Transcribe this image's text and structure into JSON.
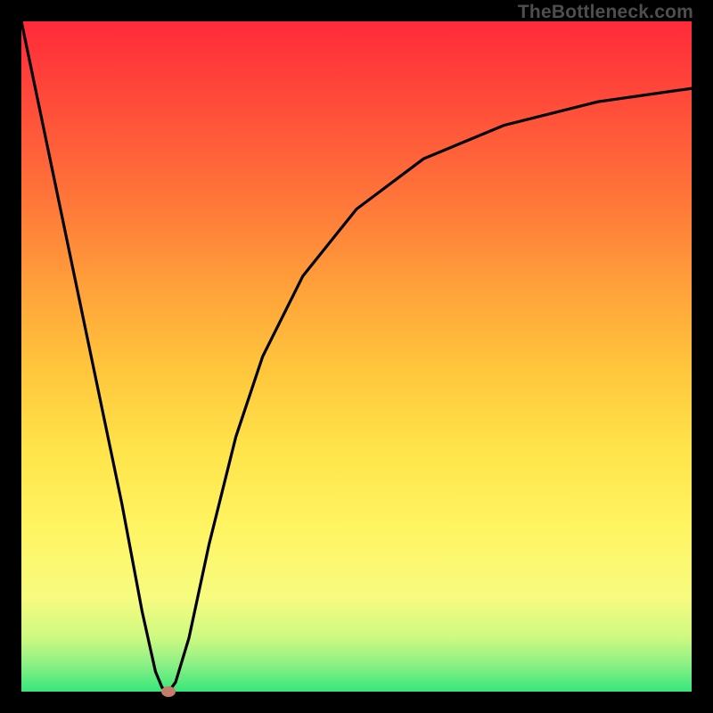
{
  "watermark": "TheBottleneck.com",
  "chart_data": {
    "type": "line",
    "title": "",
    "xlabel": "",
    "ylabel": "",
    "xlim": [
      0,
      100
    ],
    "ylim": [
      0,
      100
    ],
    "grid": false,
    "series": [
      {
        "name": "curve",
        "x": [
          0,
          5,
          10,
          15,
          18,
          20,
          21,
          22,
          23,
          25,
          28,
          32,
          36,
          42,
          50,
          60,
          72,
          86,
          100
        ],
        "y": [
          100,
          76,
          52,
          28,
          12,
          3,
          0.6,
          0,
          1.4,
          8,
          22,
          38,
          50,
          62,
          72,
          79.5,
          84.5,
          88,
          90
        ]
      }
    ],
    "marker": {
      "x": 22,
      "y": 0,
      "color": "#c77b6a"
    },
    "background_gradient": {
      "top": "#ff2a3a",
      "bottom": "#36e77a"
    }
  }
}
